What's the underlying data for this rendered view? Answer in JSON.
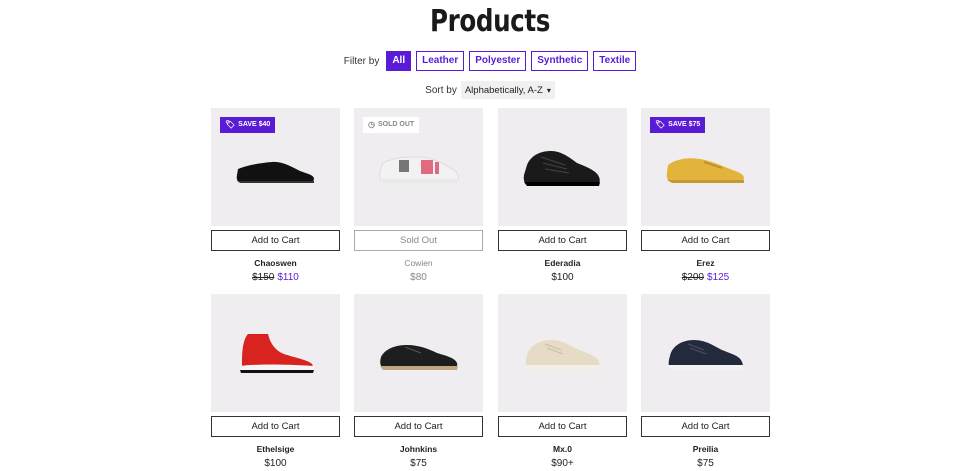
{
  "page": {
    "title": "Products"
  },
  "filter": {
    "label": "Filter by",
    "options": [
      "All",
      "Leather",
      "Polyester",
      "Synthetic",
      "Textile"
    ],
    "active": "All"
  },
  "sort": {
    "label": "Sort by",
    "value": "Alphabetically, A-Z"
  },
  "colors": {
    "accent": "#5a1bd6",
    "thumb_bg": "#efedf0"
  },
  "products": [
    {
      "name": "Chaoswen",
      "badge": "SAVE $40",
      "badge_icon": "tag-icon",
      "old_price": "$150",
      "price": "$110",
      "button": "Add to Cart",
      "sold_out": false
    },
    {
      "name": "Cowien",
      "badge": "SOLD OUT",
      "badge_icon": "clock-icon",
      "old_price": "",
      "price": "$80",
      "button": "Sold Out",
      "sold_out": true
    },
    {
      "name": "Ederadia",
      "badge": "",
      "old_price": "",
      "price": "$100",
      "button": "Add to Cart",
      "sold_out": false
    },
    {
      "name": "Erez",
      "badge": "SAVE $75",
      "badge_icon": "tag-icon",
      "old_price": "$200",
      "price": "$125",
      "button": "Add to Cart",
      "sold_out": false
    },
    {
      "name": "Ethelsige",
      "badge": "",
      "old_price": "",
      "price": "$100",
      "button": "Add to Cart",
      "sold_out": false
    },
    {
      "name": "Johnkins",
      "badge": "",
      "old_price": "",
      "price": "$75",
      "button": "Add to Cart",
      "sold_out": false
    },
    {
      "name": "Mx.0",
      "badge": "",
      "old_price": "",
      "price": "$90+",
      "button": "Add to Cart",
      "sold_out": false
    },
    {
      "name": "Preilia",
      "badge": "",
      "old_price": "",
      "price": "$75",
      "button": "Add to Cart",
      "sold_out": false
    }
  ]
}
